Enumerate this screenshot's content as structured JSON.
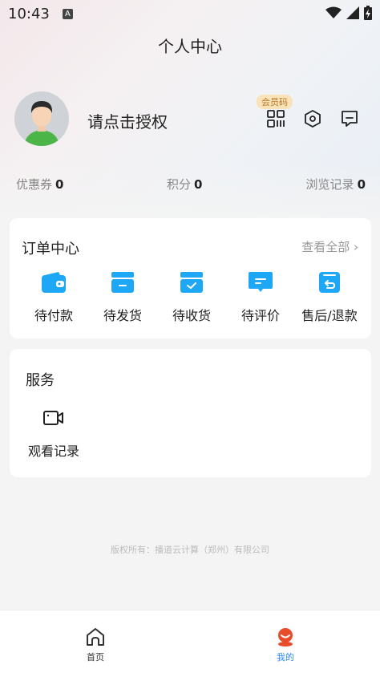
{
  "status_bar": {
    "time": "10:43",
    "badge": "A"
  },
  "header": {
    "title": "个人中心"
  },
  "profile": {
    "login_prompt": "请点击授权",
    "vip_badge": "会员码"
  },
  "stats": [
    {
      "label": "优惠券",
      "value": "0"
    },
    {
      "label": "积分",
      "value": "0"
    },
    {
      "label": "浏览记录",
      "value": "0"
    }
  ],
  "orders": {
    "title": "订单中心",
    "view_all": "查看全部",
    "items": [
      {
        "label": "待付款",
        "icon": "wallet-icon"
      },
      {
        "label": "待发货",
        "icon": "box-icon"
      },
      {
        "label": "待收货",
        "icon": "received-box-icon"
      },
      {
        "label": "待评价",
        "icon": "comment-icon"
      },
      {
        "label": "售后/退款",
        "icon": "refund-icon"
      }
    ]
  },
  "services": {
    "title": "服务",
    "items": [
      {
        "label": "观看记录",
        "icon": "video-camera-icon"
      }
    ]
  },
  "footer": {
    "copyright": "版权所有：播道云计算（郑州）有限公司"
  },
  "tabbar": {
    "items": [
      {
        "label": "首页",
        "icon": "home-icon",
        "active": false
      },
      {
        "label": "我的",
        "icon": "profile-icon",
        "active": true
      }
    ]
  },
  "colors": {
    "accent": "#1ea7f5",
    "active_tab": "#2a8cf0",
    "vip_bg": "#fbe3b9"
  }
}
